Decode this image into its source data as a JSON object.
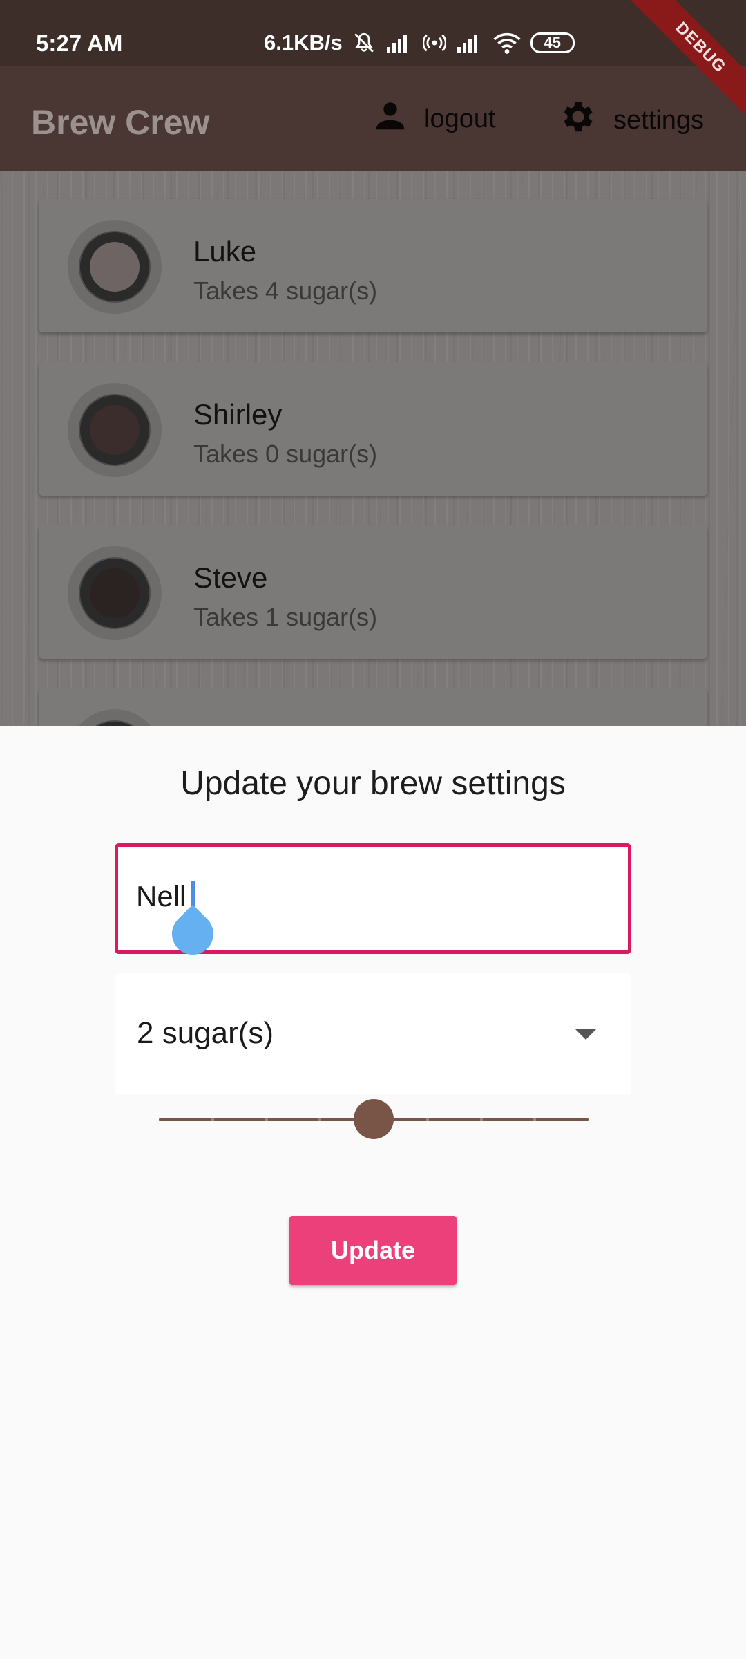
{
  "status_bar": {
    "time": "5:27 AM",
    "net_speed": "6.1KB/s",
    "battery": "45"
  },
  "debug_banner": "DEBUG",
  "app_bar": {
    "title": "Brew Crew",
    "logout_label": "logout",
    "settings_label": "settings"
  },
  "brews": [
    {
      "name": "Luke",
      "sugars_text": "Takes 4 sugar(s)",
      "strength_color": "#6d6463"
    },
    {
      "name": "Shirley",
      "sugars_text": "Takes 0 sugar(s)",
      "strength_color": "#3a2d2b"
    },
    {
      "name": "Steve",
      "sugars_text": "Takes 1 sugar(s)",
      "strength_color": "#2a2321"
    }
  ],
  "settings_form": {
    "title": "Update your brew settings",
    "name_value": "Nell",
    "sugars_value": "2 sugar(s)",
    "strength_slider": {
      "value": 0.5,
      "divisions": 8
    },
    "update_label": "Update"
  },
  "colors": {
    "accent_pink": "#ec407a",
    "field_border": "#d81b60",
    "brown": "#795548"
  }
}
